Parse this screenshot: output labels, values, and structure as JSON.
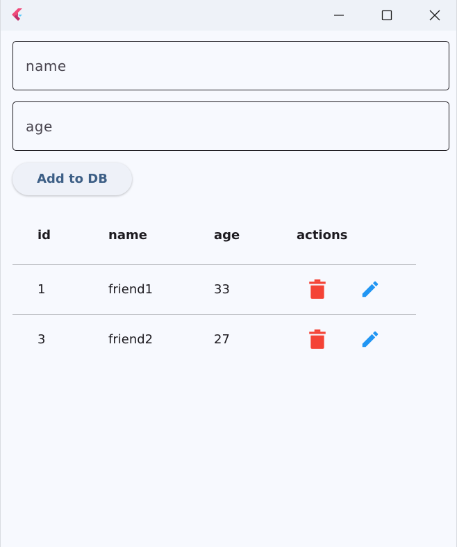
{
  "window": {
    "icons": {
      "app": "flutter-logo-icon",
      "minimize": "minimize-icon",
      "maximize": "maximize-icon",
      "close": "close-icon"
    }
  },
  "form": {
    "name_placeholder": "name",
    "age_placeholder": "age",
    "add_button_label": "Add to DB"
  },
  "table": {
    "headers": {
      "id": "id",
      "name": "name",
      "age": "age",
      "actions": "actions"
    },
    "rows": [
      {
        "id": "1",
        "name": "friend1",
        "age": "33"
      },
      {
        "id": "3",
        "name": "friend2",
        "age": "27"
      }
    ],
    "action_icons": {
      "delete": "trash-icon",
      "edit": "pencil-icon"
    }
  },
  "colors": {
    "delete": "#f44336",
    "edit": "#2196f3",
    "button_text": "#3d5f86",
    "background": "#f7f9fe"
  }
}
